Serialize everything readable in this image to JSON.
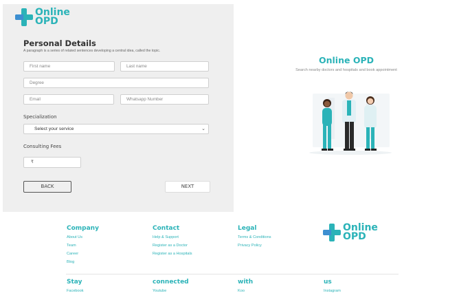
{
  "brand": {
    "line1": "Online",
    "line2": "OPD"
  },
  "form": {
    "title": "Personal Details",
    "description": "A paragraph is a series of related sentences developing a central idea, called the topic.",
    "first_name_placeholder": "First name",
    "last_name_placeholder": "Last name",
    "degree_placeholder": "Degree",
    "email_placeholder": "Email",
    "whatsapp_placeholder": "Whatsapp Number",
    "specialization_label": "Specialization",
    "specialization_value": "Select your service",
    "fees_label": "Consulting Fees",
    "fees_value": "₹",
    "back_label": "BACK",
    "next_label": "NEXT"
  },
  "hero": {
    "title": "Online OPD",
    "subtitle": "Search nearby doctors and hospitals and book appointment"
  },
  "footer": {
    "company": {
      "heading": "Company",
      "links": [
        "About Us",
        "Team",
        "Career",
        "Blog"
      ]
    },
    "contact": {
      "heading": "Contact",
      "links": [
        "Help & Support",
        "Register as a Doctor",
        "Register as a Hospitals"
      ]
    },
    "legal": {
      "heading": "Legal",
      "links": [
        "Terms & Conditions",
        "Privacy Policy"
      ]
    },
    "social": [
      {
        "heading": "Stay",
        "link": "Facebook"
      },
      {
        "heading": "connected",
        "link": "Youtube"
      },
      {
        "heading": "with",
        "link": "Koo"
      },
      {
        "heading": "us",
        "link": "Instagram"
      }
    ]
  },
  "colors": {
    "accent": "#2bb3b8",
    "accent_blue": "#3d8fd1",
    "panel": "#efefef"
  },
  "icons": {
    "brand": "medical-cross-icon",
    "dropdown": "chevron-down-icon"
  }
}
